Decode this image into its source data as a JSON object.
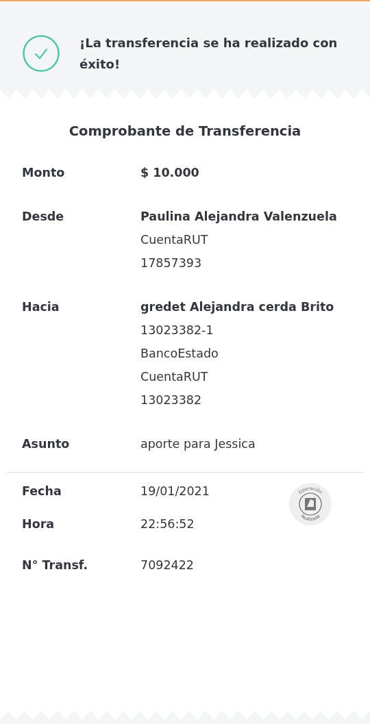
{
  "banner": {
    "message": "¡La transferencia se ha realizado con éxito!"
  },
  "receipt": {
    "title": "Comprobante de Transferencia",
    "rows": [
      {
        "label": "Monto",
        "values": [
          "$ 10.000"
        ]
      },
      {
        "label": "Desde",
        "values": [
          "Paulina Alejandra Valenzuela",
          "CuentaRUT",
          "17857393"
        ]
      },
      {
        "label": "Hacia",
        "values": [
          "gredet Alejandra cerda Brito",
          "13023382-1",
          "BancoEstado",
          "CuentaRUT",
          "13023382"
        ]
      },
      {
        "label": "Asunto",
        "values": [
          "aporte para Jessica"
        ]
      }
    ],
    "details": [
      {
        "label": "Fecha",
        "value": "19/01/2021"
      },
      {
        "label": "Hora",
        "value": "22:56:52"
      },
      {
        "label": "N° Transf.",
        "value": "7092422"
      }
    ],
    "stamp": {
      "top": "Operación",
      "bottom": "Realizada"
    }
  }
}
